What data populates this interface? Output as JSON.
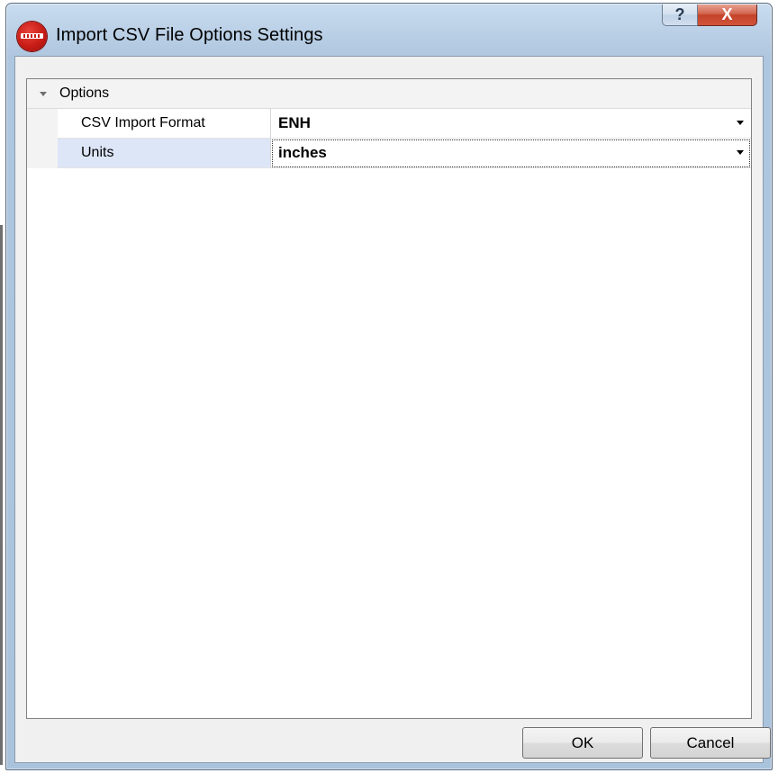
{
  "window": {
    "title": "Import CSV File Options Settings",
    "help_label": "?",
    "close_label": "X"
  },
  "grid": {
    "category": {
      "label": "Options",
      "expanded": true
    },
    "properties": [
      {
        "name": "CSV Import Format",
        "value": "ENH"
      },
      {
        "name": "Units",
        "value": "inches",
        "selected": true
      }
    ]
  },
  "buttons": {
    "ok": "OK",
    "cancel": "Cancel"
  },
  "colors": {
    "title_bar": "#b7cde4",
    "selected_row": "#dde6f7",
    "close_button": "#c4432a",
    "app_icon": "#c71c16"
  }
}
